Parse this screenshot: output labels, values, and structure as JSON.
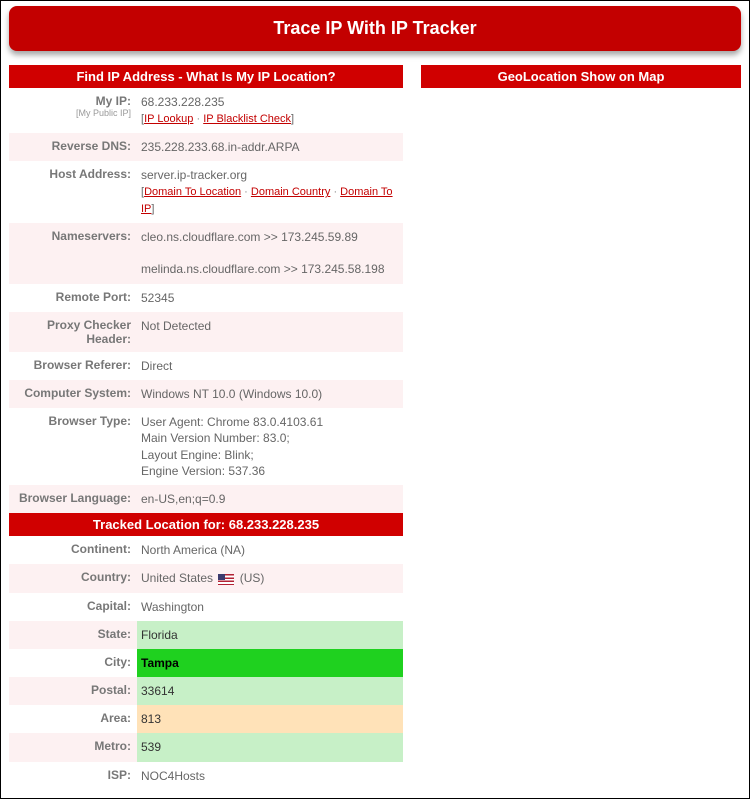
{
  "header": {
    "title": "Trace IP With IP Tracker"
  },
  "leftSection": {
    "title": "Find IP Address - What Is My IP Location?",
    "myIp": {
      "label": "My IP:",
      "sublabel": "[My Public IP]",
      "value": "68.233.228.235",
      "linkLookup": "IP Lookup",
      "linkBlacklist": "IP Blacklist Check"
    },
    "reverseDns": {
      "label": "Reverse DNS:",
      "value": "235.228.233.68.in-addr.ARPA"
    },
    "hostAddress": {
      "label": "Host Address:",
      "value": "server.ip-tracker.org",
      "linkDomainLocation": "Domain To Location",
      "linkDomainCountry": "Domain Country",
      "linkDomainIp": "Domain To IP"
    },
    "nameservers": {
      "label": "Nameservers:",
      "line1": "cleo.ns.cloudflare.com >> 173.245.59.89",
      "line2": "melinda.ns.cloudflare.com >> 173.245.58.198"
    },
    "remotePort": {
      "label": "Remote Port:",
      "value": "52345"
    },
    "proxyChecker": {
      "label": "Proxy Checker Header:",
      "value": "Not Detected"
    },
    "browserReferer": {
      "label": "Browser Referer:",
      "value": "Direct"
    },
    "computerSystem": {
      "label": "Computer System:",
      "value": "Windows NT 10.0 (Windows 10.0)"
    },
    "browserType": {
      "label": "Browser Type:",
      "line1": "User Agent: Chrome 83.0.4103.61",
      "line2": "Main Version Number: 83.0;",
      "line3": "Layout Engine: Blink;",
      "line4": "Engine Version: 537.36"
    },
    "browserLanguage": {
      "label": "Browser Language:",
      "value": "en-US,en;q=0.9"
    }
  },
  "trackedSection": {
    "title": "Tracked Location for: 68.233.228.235",
    "continent": {
      "label": "Continent:",
      "value": "North America (NA)"
    },
    "country": {
      "label": "Country:",
      "prefix": "United States",
      "suffix": "(US)"
    },
    "capital": {
      "label": "Capital:",
      "value": "Washington"
    },
    "state": {
      "label": "State:",
      "value": "Florida"
    },
    "city": {
      "label": "City:",
      "value": "Tampa"
    },
    "postal": {
      "label": "Postal:",
      "value": "33614"
    },
    "area": {
      "label": "Area:",
      "value": "813"
    },
    "metro": {
      "label": "Metro:",
      "value": "539"
    },
    "isp": {
      "label": "ISP:",
      "value": "NOC4Hosts"
    }
  },
  "rightSection": {
    "title": "GeoLocation Show on Map"
  }
}
